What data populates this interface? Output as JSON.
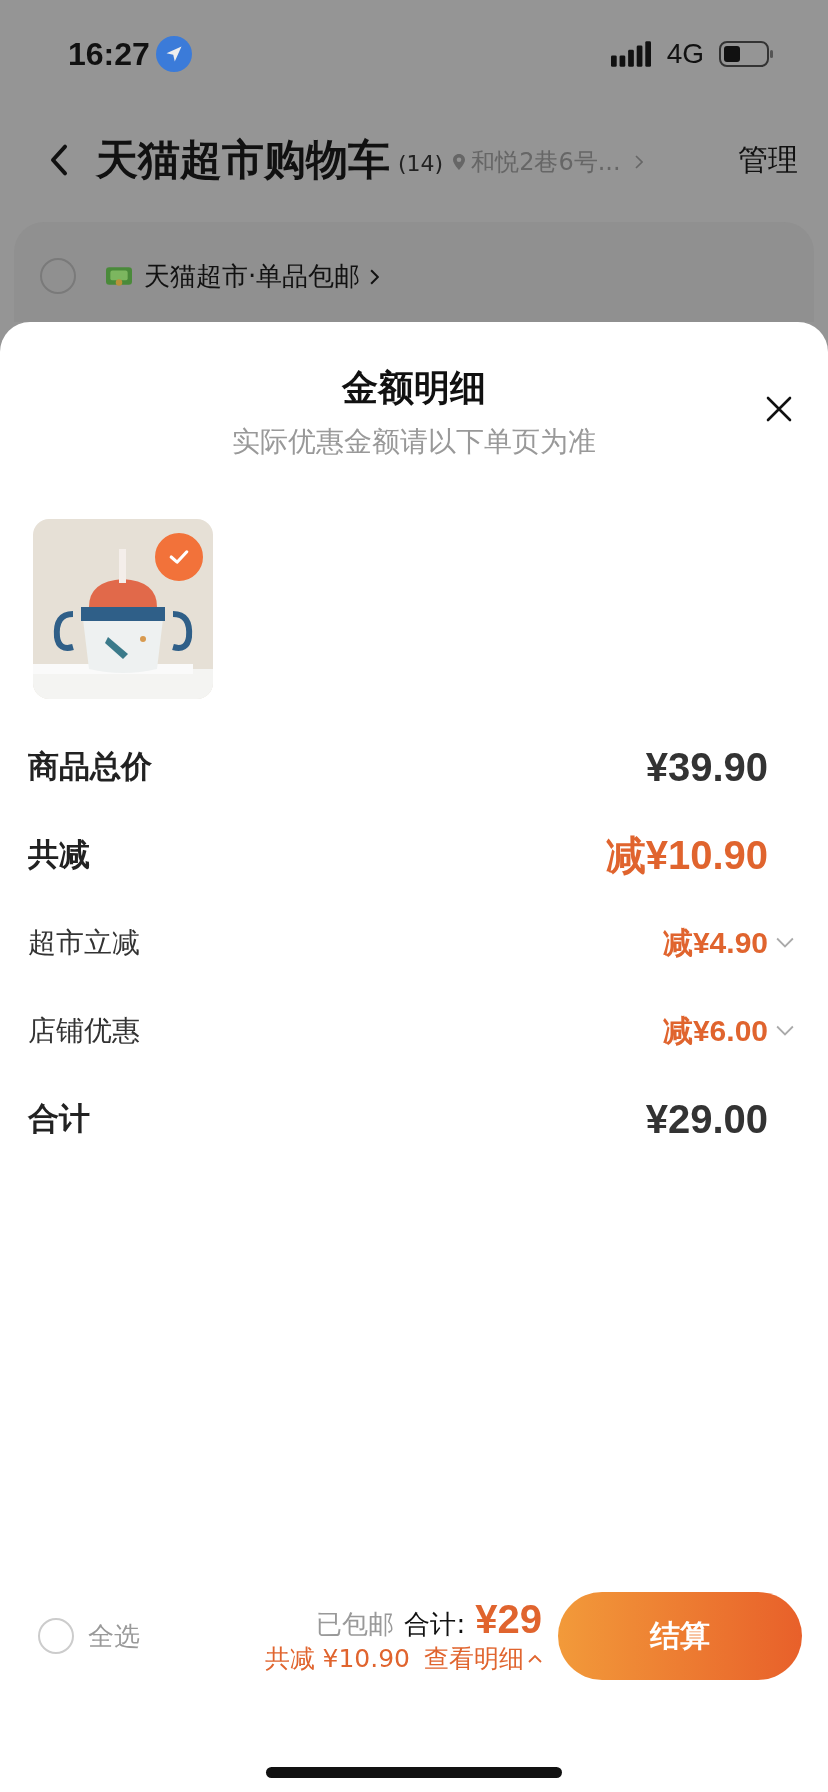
{
  "status_bar": {
    "time": "16:27",
    "network": "4G"
  },
  "header": {
    "title": "天猫超市购物车",
    "count": "(14)",
    "address": "和悦2巷6号...",
    "manage": "管理"
  },
  "store": {
    "name": "天猫超市·单品包邮",
    "checked": false
  },
  "sheet": {
    "title": "金额明细",
    "subtitle": "实际优惠金额请以下单页为准",
    "products": [
      {
        "kind": "picture",
        "checked": true
      }
    ],
    "rows": [
      {
        "label": "商品总价",
        "value": "¥39.90",
        "kind": "major",
        "discount": false,
        "expandable": false
      },
      {
        "label": "共减",
        "value": "减¥10.90",
        "kind": "major",
        "discount": true,
        "expandable": false
      },
      {
        "label": "超市立减",
        "value": "减¥4.90",
        "kind": "minor",
        "discount": true,
        "expandable": true
      },
      {
        "label": "店铺优惠",
        "value": "减¥6.00",
        "kind": "minor",
        "discount": true,
        "expandable": true
      },
      {
        "label": "合计",
        "value": "¥29.00",
        "kind": "major",
        "discount": false,
        "expandable": false
      }
    ]
  },
  "footer": {
    "select_all": {
      "label": "全选",
      "checked": false
    },
    "shipping": "已包邮",
    "total_label": "合计:",
    "total": "¥29",
    "saved": "共减 ¥10.90",
    "details": "查看明细",
    "checkout": "结算"
  }
}
